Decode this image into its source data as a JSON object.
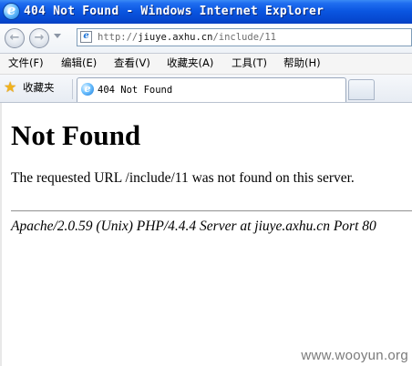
{
  "window": {
    "title": "404 Not Found - Windows Internet Explorer",
    "icon": "ie-logo-icon"
  },
  "navigation": {
    "back_icon": "back-arrow-icon",
    "forward_icon": "forward-arrow-icon",
    "address_prefix": "http://",
    "address_host": "jiuye.axhu.cn",
    "address_path": "/include/11"
  },
  "menu": {
    "items": [
      {
        "label": "文件(F)"
      },
      {
        "label": "编辑(E)"
      },
      {
        "label": "查看(V)"
      },
      {
        "label": "收藏夹(A)"
      },
      {
        "label": "工具(T)"
      },
      {
        "label": "帮助(H)"
      }
    ]
  },
  "favorites": {
    "label": "收藏夹",
    "icon": "star-icon"
  },
  "tabs": [
    {
      "title": "404 Not Found",
      "active": true
    }
  ],
  "page": {
    "heading": "Not Found",
    "message": "The requested URL /include/11 was not found on this server.",
    "signature": "Apache/2.0.59 (Unix) PHP/4.4.4 Server at jiuye.axhu.cn Port 80"
  },
  "watermark": "www.wooyun.org",
  "colors": {
    "titlebar_blue": "#0a55e0",
    "address_border": "#7f9db9",
    "favorites_star": "#f1b21c"
  }
}
